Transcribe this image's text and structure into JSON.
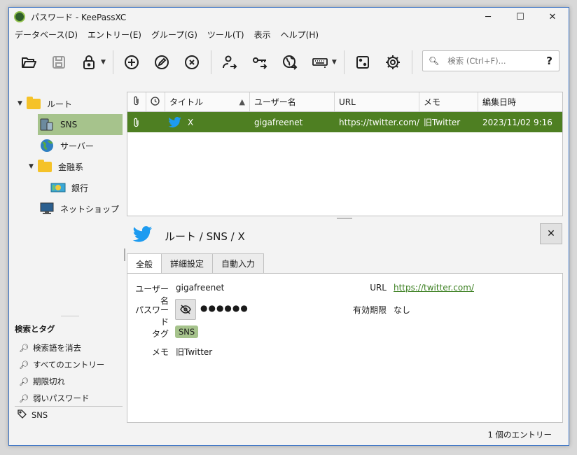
{
  "window": {
    "title": "パスワード - KeePassXC",
    "controls": {
      "minimize": "─",
      "maximize": "☐",
      "close": "✕"
    }
  },
  "menu": [
    "データベース(D)",
    "エントリー(E)",
    "グループ(G)",
    "ツール(T)",
    "表示",
    "ヘルプ(H)"
  ],
  "search": {
    "placeholder": "検索 (Ctrl+F)...",
    "help": "?"
  },
  "groups": [
    {
      "label": "ルート",
      "expanded": true
    },
    {
      "label": "SNS",
      "selected": true
    },
    {
      "label": "サーバー"
    },
    {
      "label": "金融系",
      "expanded": true
    },
    {
      "label": "銀行"
    },
    {
      "label": "ネットショップ"
    }
  ],
  "tags_section": {
    "title": "検索とタグ",
    "searches": [
      "検索語を消去",
      "すべてのエントリー",
      "期限切れ",
      "弱いパスワード"
    ],
    "tags": [
      "SNS"
    ]
  },
  "table": {
    "columns": [
      "タイトル",
      "ユーザー名",
      "URL",
      "メモ",
      "編集日時"
    ],
    "rows": [
      {
        "title": "X",
        "username": "gigafreenet",
        "url": "https://twitter.com/",
        "notes": "旧Twitter",
        "modified": "2023/11/02 9:16"
      }
    ]
  },
  "detail": {
    "path": "ルート / SNS / X",
    "tabs": [
      "全般",
      "詳細設定",
      "自動入力"
    ],
    "fields": {
      "username_label": "ユーザー名",
      "username": "gigafreenet",
      "password_label": "パスワード",
      "password": "●●●●●●",
      "tags_label": "タグ",
      "tag": "SNS",
      "notes_label": "メモ",
      "notes": "旧Twitter",
      "url_label": "URL",
      "url": "https://twitter.com/",
      "expiry_label": "有効期限",
      "expiry": "なし"
    }
  },
  "status": "1 個のエントリー",
  "colors": {
    "selection": "#4e7f22",
    "tree_selection": "#a6c38c",
    "link": "#3b7f20",
    "twitter": "#1d9bf0"
  }
}
